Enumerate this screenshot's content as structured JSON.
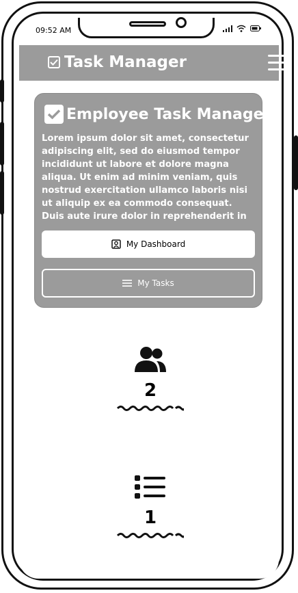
{
  "status": {
    "time": "09:52 AM"
  },
  "appbar": {
    "title": "Task Manager"
  },
  "hero": {
    "title": "Employee Task Manager",
    "body": "Lorem ipsum dolor sit amet, consectetur adipiscing elit, sed do eiusmod tempor incididunt ut labore et dolore magna aliqua. Ut enim ad minim veniam, quis nostrud exercitation ullamco laboris nisi ut aliquip ex ea commodo consequat. Duis aute irure dolor in reprehenderit in",
    "dashboard_label": "My Dashboard",
    "tasks_label": "My Tasks"
  },
  "stats": [
    {
      "icon": "users-icon",
      "value": "2"
    },
    {
      "icon": "list-icon",
      "value": "1"
    }
  ],
  "colors": {
    "bar": "#9b9b9b",
    "text_on_bar": "#ffffff"
  }
}
